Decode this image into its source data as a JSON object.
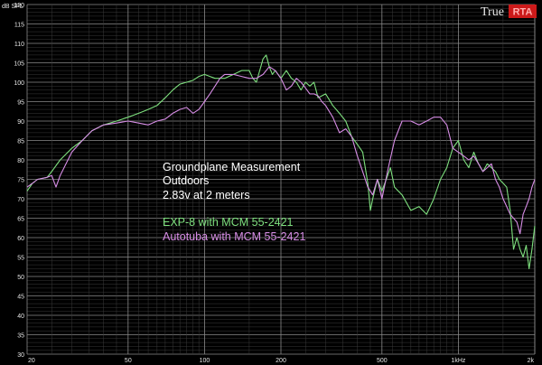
{
  "chart_data": {
    "type": "line",
    "xscale": "log",
    "xlim": [
      20,
      2000
    ],
    "ylim": [
      30,
      120
    ],
    "ylabel": "dB SPL",
    "grid": true,
    "x_major_ticks": [
      {
        "value": 20,
        "label": "20"
      },
      {
        "value": 50,
        "label": "50"
      },
      {
        "value": 100,
        "label": "100"
      },
      {
        "value": 200,
        "label": "200"
      },
      {
        "value": 500,
        "label": "500"
      },
      {
        "value": 1000,
        "label": "1kHz"
      },
      {
        "value": 2000,
        "label": "2k"
      }
    ],
    "y_ticks": [
      120,
      115,
      110,
      105,
      100,
      95,
      90,
      85,
      80,
      75,
      70,
      65,
      60,
      55,
      50,
      45,
      40,
      35,
      30
    ],
    "annotations": [
      "Groundplane Measurement",
      "Outdoors",
      "2.83v at 2 meters"
    ],
    "series": [
      {
        "name": "EXP-8 with MCM 55-2421",
        "color": "#7ee07e",
        "points": [
          [
            20,
            72
          ],
          [
            21,
            74
          ],
          [
            22,
            75
          ],
          [
            24,
            75.5
          ],
          [
            25,
            77
          ],
          [
            27,
            80
          ],
          [
            30,
            83
          ],
          [
            33,
            85
          ],
          [
            36,
            87.5
          ],
          [
            40,
            89
          ],
          [
            45,
            90
          ],
          [
            50,
            91
          ],
          [
            55,
            92
          ],
          [
            60,
            93
          ],
          [
            65,
            94
          ],
          [
            70,
            96
          ],
          [
            75,
            98
          ],
          [
            80,
            99.5
          ],
          [
            85,
            100
          ],
          [
            90,
            100.5
          ],
          [
            95,
            101.5
          ],
          [
            100,
            102
          ],
          [
            105,
            101.5
          ],
          [
            110,
            101
          ],
          [
            120,
            101
          ],
          [
            130,
            102
          ],
          [
            140,
            103
          ],
          [
            150,
            103
          ],
          [
            155,
            101
          ],
          [
            160,
            100
          ],
          [
            165,
            103
          ],
          [
            170,
            106
          ],
          [
            175,
            107
          ],
          [
            180,
            104
          ],
          [
            185,
            102
          ],
          [
            190,
            103
          ],
          [
            200,
            101
          ],
          [
            210,
            103
          ],
          [
            220,
            101
          ],
          [
            230,
            100
          ],
          [
            240,
            98
          ],
          [
            250,
            100
          ],
          [
            260,
            99
          ],
          [
            270,
            100
          ],
          [
            280,
            96
          ],
          [
            300,
            97
          ],
          [
            320,
            94
          ],
          [
            340,
            92
          ],
          [
            360,
            90
          ],
          [
            380,
            86
          ],
          [
            400,
            84
          ],
          [
            420,
            82
          ],
          [
            440,
            74
          ],
          [
            450,
            67
          ],
          [
            460,
            70
          ],
          [
            480,
            75
          ],
          [
            500,
            72
          ],
          [
            520,
            75
          ],
          [
            540,
            78
          ],
          [
            560,
            73
          ],
          [
            600,
            71
          ],
          [
            650,
            67
          ],
          [
            700,
            68
          ],
          [
            750,
            66
          ],
          [
            800,
            70
          ],
          [
            850,
            75
          ],
          [
            900,
            78
          ],
          [
            950,
            83
          ],
          [
            1000,
            85
          ],
          [
            1050,
            80
          ],
          [
            1100,
            78
          ],
          [
            1150,
            82
          ],
          [
            1200,
            79
          ],
          [
            1250,
            77
          ],
          [
            1300,
            79
          ],
          [
            1350,
            78
          ],
          [
            1400,
            77
          ],
          [
            1450,
            75
          ],
          [
            1500,
            74
          ],
          [
            1550,
            73
          ],
          [
            1600,
            67
          ],
          [
            1650,
            57
          ],
          [
            1700,
            60
          ],
          [
            1750,
            57
          ],
          [
            1800,
            55
          ],
          [
            1850,
            58
          ],
          [
            1900,
            52
          ],
          [
            1950,
            57
          ],
          [
            2000,
            63
          ]
        ]
      },
      {
        "name": "Autotuba with MCM 55-2421",
        "color": "#d78de6",
        "points": [
          [
            20,
            73
          ],
          [
            21,
            74
          ],
          [
            22,
            75
          ],
          [
            24,
            75.5
          ],
          [
            25,
            76
          ],
          [
            26,
            73
          ],
          [
            27,
            76
          ],
          [
            30,
            82
          ],
          [
            33,
            85
          ],
          [
            36,
            87.5
          ],
          [
            40,
            89
          ],
          [
            45,
            89.5
          ],
          [
            50,
            90
          ],
          [
            55,
            89.5
          ],
          [
            60,
            89
          ],
          [
            65,
            90
          ],
          [
            70,
            90.5
          ],
          [
            75,
            92
          ],
          [
            80,
            93
          ],
          [
            85,
            93.5
          ],
          [
            90,
            92
          ],
          [
            95,
            93
          ],
          [
            100,
            95
          ],
          [
            105,
            97
          ],
          [
            110,
            99
          ],
          [
            115,
            101
          ],
          [
            120,
            102
          ],
          [
            130,
            102
          ],
          [
            140,
            101.5
          ],
          [
            150,
            101
          ],
          [
            160,
            101
          ],
          [
            170,
            102
          ],
          [
            180,
            104
          ],
          [
            190,
            103
          ],
          [
            200,
            101
          ],
          [
            210,
            98
          ],
          [
            220,
            99
          ],
          [
            230,
            101
          ],
          [
            240,
            100
          ],
          [
            250,
            98.5
          ],
          [
            260,
            97
          ],
          [
            270,
            97
          ],
          [
            280,
            96.5
          ],
          [
            290,
            95
          ],
          [
            300,
            94
          ],
          [
            320,
            91
          ],
          [
            340,
            87
          ],
          [
            360,
            88
          ],
          [
            380,
            86
          ],
          [
            400,
            81
          ],
          [
            420,
            77
          ],
          [
            440,
            73
          ],
          [
            460,
            71
          ],
          [
            480,
            75
          ],
          [
            500,
            70
          ],
          [
            530,
            78
          ],
          [
            560,
            85
          ],
          [
            600,
            90
          ],
          [
            650,
            90
          ],
          [
            700,
            89
          ],
          [
            750,
            90
          ],
          [
            800,
            91
          ],
          [
            850,
            91
          ],
          [
            900,
            89
          ],
          [
            950,
            83
          ],
          [
            1000,
            82
          ],
          [
            1050,
            81
          ],
          [
            1100,
            80
          ],
          [
            1150,
            81
          ],
          [
            1200,
            79
          ],
          [
            1250,
            77
          ],
          [
            1300,
            78
          ],
          [
            1350,
            79
          ],
          [
            1400,
            75
          ],
          [
            1450,
            73
          ],
          [
            1500,
            70
          ],
          [
            1550,
            68
          ],
          [
            1600,
            66
          ],
          [
            1650,
            65
          ],
          [
            1700,
            64
          ],
          [
            1750,
            61
          ],
          [
            1800,
            66
          ],
          [
            1850,
            68
          ],
          [
            1900,
            70
          ],
          [
            1950,
            73
          ],
          [
            2000,
            75
          ]
        ]
      }
    ]
  },
  "brand": {
    "word": "True",
    "rta_letters": "RTA",
    "rta_color": "#e02020"
  }
}
